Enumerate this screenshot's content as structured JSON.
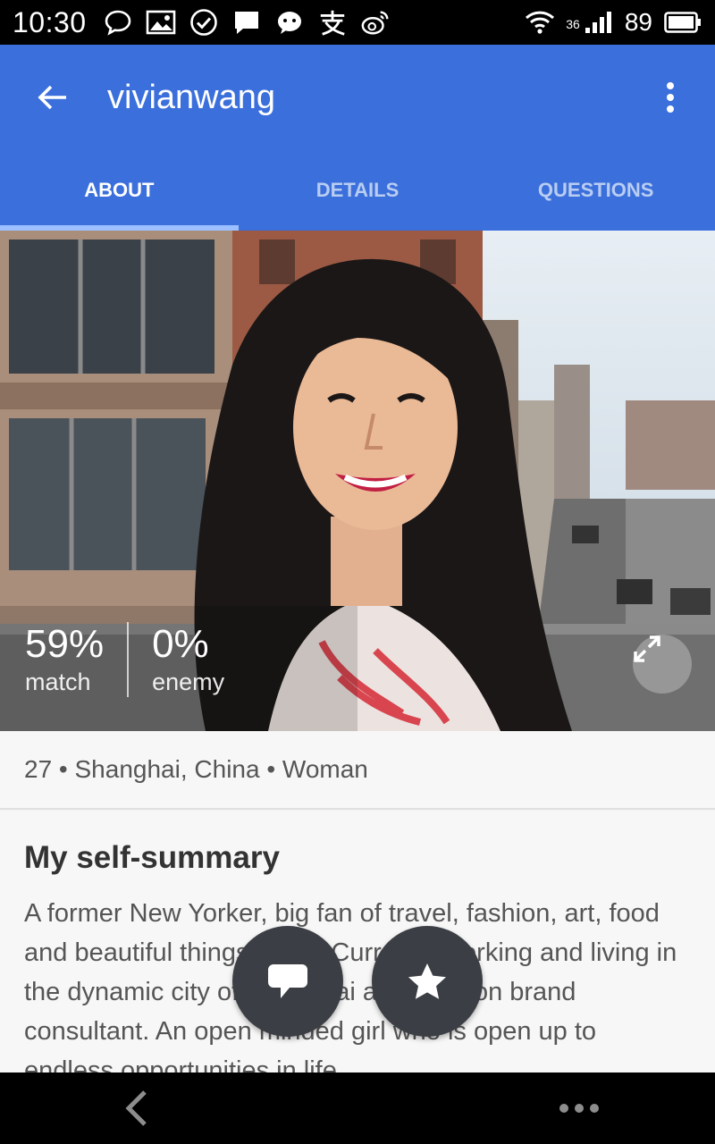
{
  "status_bar": {
    "time": "10:30",
    "network": "36",
    "battery": "89",
    "icons": [
      "chat-bubble-icon",
      "image-icon",
      "check-circle-icon",
      "message-icon",
      "wechat-icon",
      "alipay-icon",
      "weibo-icon",
      "wifi-icon",
      "signal-icon",
      "battery-icon"
    ]
  },
  "header": {
    "title": "vivianwang",
    "tabs": [
      {
        "label": "ABOUT",
        "active": true
      },
      {
        "label": "DETAILS",
        "active": false
      },
      {
        "label": "QUESTIONS",
        "active": false
      }
    ]
  },
  "profile": {
    "match_value": "59%",
    "match_label": "match",
    "enemy_value": "0%",
    "enemy_label": "enemy",
    "info_line": "27 • Shanghai, China • Woman"
  },
  "summary": {
    "heading": "My self-summary",
    "text": "A former New Yorker, big fan of travel, fashion, art, food and beautiful things in life. Currently working and living in the dynamic city of Shanghai as a fashion brand consultant. An open minded girl who is open up to endless opportunities in life."
  },
  "colors": {
    "app_bar": "#3b6fdb",
    "tab_inactive": "#b9cdf2",
    "fab": "#3b3f45"
  }
}
